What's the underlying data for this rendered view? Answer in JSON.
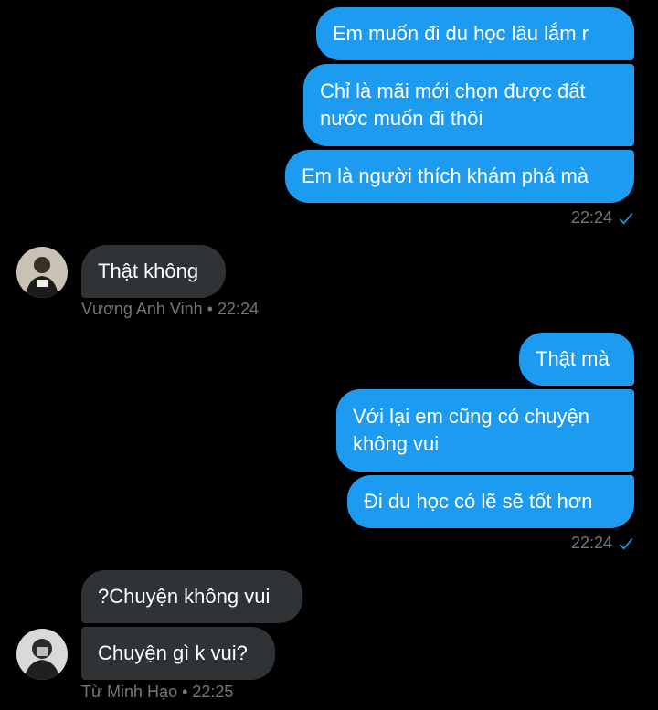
{
  "messages": {
    "out1": [
      "Em muốn đi du học lâu lắm r",
      "Chỉ là mãi mới chọn được đất\nnước muốn đi thôi",
      "Em là người thích khám phá mà"
    ],
    "out1_time": "22:24",
    "in1": "Thật không",
    "in1_meta": "Vương Anh Vinh • 22:24",
    "out2": [
      "Thật mà",
      "Với lại em cũng có chuyện\nkhông vui",
      "Đi du học có lẽ sẽ tốt hơn"
    ],
    "out2_time": "22:24",
    "in2": [
      "?Chuyện không vui",
      "Chuyện gì k vui?"
    ],
    "in2_meta": "Từ Minh Hạo • 22:25"
  },
  "colors": {
    "outgoing": "#1d9bf0",
    "incoming": "#2f3336",
    "meta": "#71767b"
  },
  "icons": {
    "read_receipt": "check-icon"
  }
}
